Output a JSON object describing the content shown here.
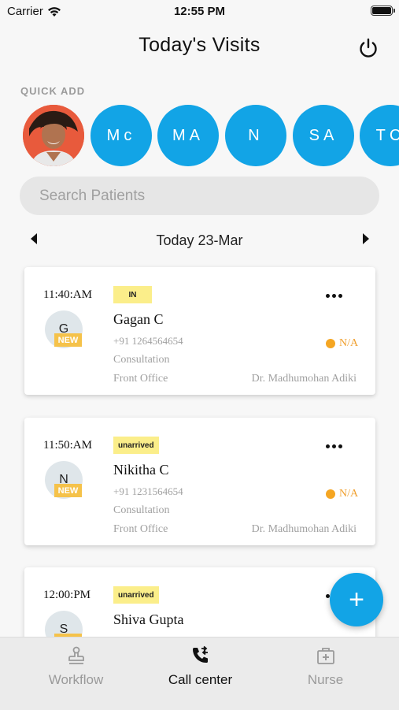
{
  "status_bar": {
    "carrier": "Carrier",
    "time": "12:55 PM"
  },
  "header": {
    "title": "Today's Visits",
    "power_icon": "power-icon"
  },
  "quick_add": {
    "label": "QUICK ADD",
    "contacts": [
      "Mc",
      "MA",
      "N",
      "SA",
      "TC"
    ]
  },
  "search": {
    "placeholder": "Search Patients"
  },
  "date_nav": {
    "label": "Today 23-Mar"
  },
  "visits": [
    {
      "time": "11:40:AM",
      "status": "IN",
      "initial": "G",
      "badge": "NEW",
      "name": "Gagan C",
      "phone": "+91 1264564654",
      "type": "Consultation",
      "location": "Front Office",
      "doctor": "Dr. Madhumohan Adiki",
      "eta": "N/A"
    },
    {
      "time": "11:50:AM",
      "status": "unarrived",
      "initial": "N",
      "badge": "NEW",
      "name": "Nikitha C",
      "phone": "+91 1231564654",
      "type": "Consultation",
      "location": "Front Office",
      "doctor": "Dr. Madhumohan Adiki",
      "eta": "N/A"
    },
    {
      "time": "12:00:PM",
      "status": "unarrived",
      "initial": "S",
      "badge": "NEW",
      "name": "Shiva Gupta"
    }
  ],
  "fab": {
    "label": "+"
  },
  "tabs": [
    {
      "label": "Workflow",
      "icon": "stamp-icon"
    },
    {
      "label": "Call center",
      "icon": "phone-transfer-icon"
    },
    {
      "label": "Nurse",
      "icon": "first-aid-kit-icon"
    }
  ],
  "colors": {
    "accent": "#12a4e6",
    "status_badge": "#fbee8a",
    "new_badge": "#f5c24a",
    "eta": "#f0a030"
  }
}
